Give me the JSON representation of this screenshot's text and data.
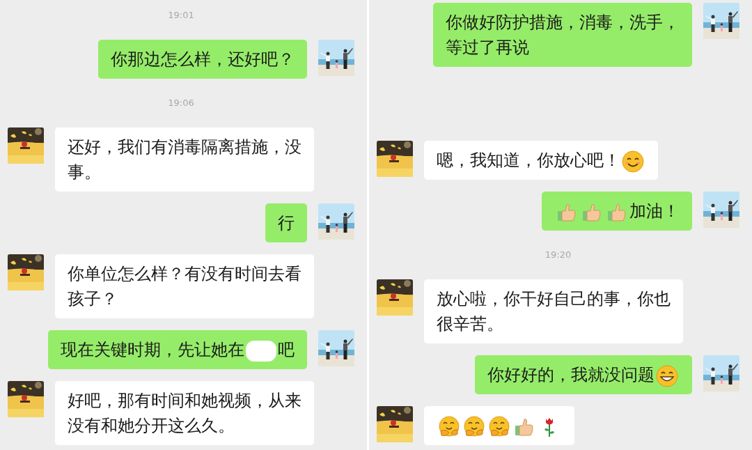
{
  "panels": [
    {
      "items": [
        {
          "kind": "time",
          "text": "19:01"
        },
        {
          "kind": "sent",
          "parts": [
            {
              "kind": "text",
              "text": "你那边怎么样，还好吧？"
            }
          ]
        },
        {
          "kind": "time",
          "text": "19:06"
        },
        {
          "kind": "received",
          "parts": [
            {
              "kind": "text",
              "text": "还好，我们有消毒隔离措施，没事。"
            }
          ]
        },
        {
          "kind": "sent",
          "parts": [
            {
              "kind": "text",
              "text": "行"
            }
          ]
        },
        {
          "kind": "received",
          "parts": [
            {
              "kind": "text",
              "text": "你单位怎么样？有没有时间去看孩子？"
            }
          ]
        },
        {
          "kind": "sent",
          "parts": [
            {
              "kind": "text",
              "text": "现在关键时期，先让她在"
            },
            {
              "kind": "redacted"
            },
            {
              "kind": "text",
              "text": "吧"
            }
          ]
        },
        {
          "kind": "received",
          "parts": [
            {
              "kind": "text",
              "text": "好吧，那有时间和她视频，从来没有和她分开这么久。"
            }
          ]
        }
      ]
    },
    {
      "items": [
        {
          "kind": "sent",
          "parts": [
            {
              "kind": "text",
              "text": "你做好防护措施，消毒，洗手，等过了再说"
            }
          ]
        },
        {
          "kind": "received",
          "parts": [
            {
              "kind": "text",
              "text": "嗯，我知道，你放心吧！"
            },
            {
              "kind": "smile"
            }
          ]
        },
        {
          "kind": "sent",
          "parts": [
            {
              "kind": "thumbs_up"
            },
            {
              "kind": "thumbs_up"
            },
            {
              "kind": "thumbs_up"
            },
            {
              "kind": "text",
              "text": "加油！"
            }
          ]
        },
        {
          "kind": "time",
          "text": "19:20"
        },
        {
          "kind": "received",
          "parts": [
            {
              "kind": "text",
              "text": "放心啦，你干好自己的事，你也很辛苦。"
            }
          ]
        },
        {
          "kind": "sent",
          "parts": [
            {
              "kind": "text",
              "text": "你好好的，我就没问题"
            },
            {
              "kind": "grin"
            }
          ]
        },
        {
          "kind": "received",
          "parts": [
            {
              "kind": "hug"
            },
            {
              "kind": "hug"
            },
            {
              "kind": "hug"
            },
            {
              "kind": "thumbs_up"
            },
            {
              "kind": "rose"
            }
          ]
        }
      ]
    }
  ]
}
